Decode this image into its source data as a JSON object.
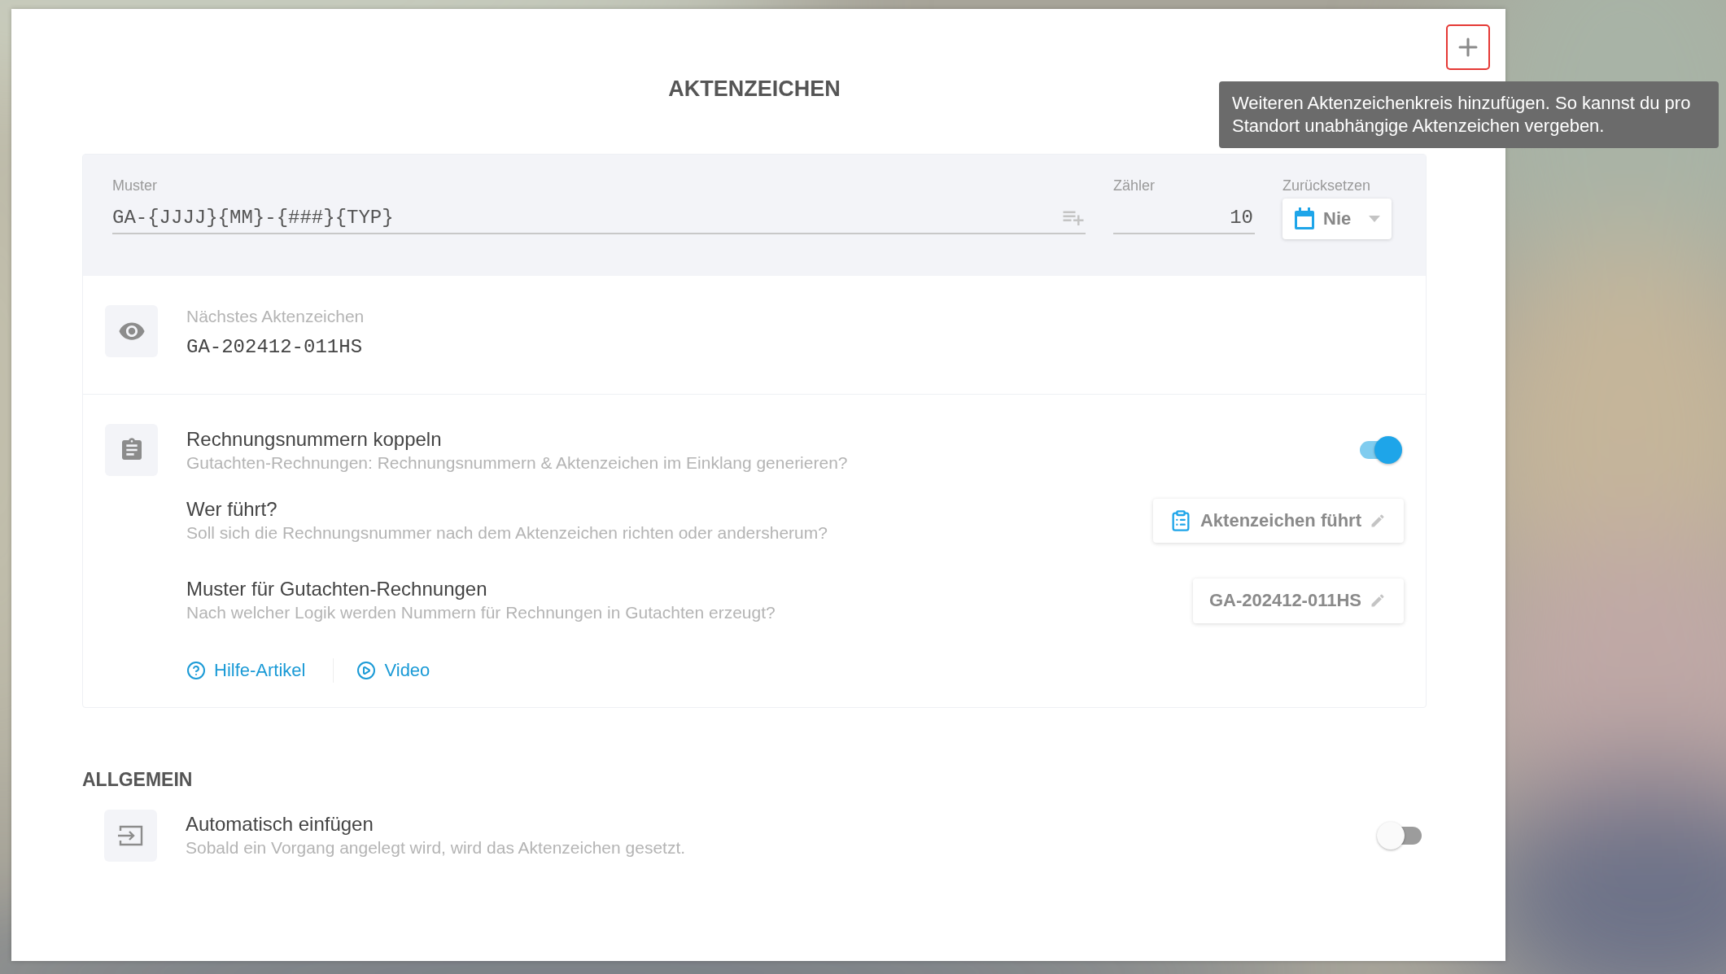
{
  "header": {
    "title": "AKTENZEICHEN",
    "add_button": {
      "tooltip": "Weiteren Aktenzeichenkreis hinzufügen. So kannst du pro Standort unabhängige Aktenzeichen vergeben."
    }
  },
  "pattern_form": {
    "fields": [
      {
        "kind": "pattern",
        "label": "Muster",
        "value": "GA-{JJJJ}{MM}-{###}{TYP}"
      },
      {
        "kind": "number",
        "label": "Zähler",
        "value": "10"
      },
      {
        "kind": "select",
        "label": "Zurücksetzen",
        "value": "Nie"
      }
    ]
  },
  "next_number": {
    "label": "Nächstes Aktenzeichen",
    "value": "GA-202412-011HS"
  },
  "coupling": {
    "title": "Rechnungsnummern koppeln",
    "subtitle": "Gutachten-Rechnungen: Rechnungsnummern & Aktenzeichen im Einklang generieren?",
    "on": true,
    "options": [
      {
        "kind": "icon",
        "title": "Wer führt?",
        "subtitle": "Soll sich die Rechnungsnummer nach dem Aktenzeichen richten oder andersherum?",
        "button": "Aktenzeichen führt"
      },
      {
        "kind": "plain",
        "title": "Muster für Gutachten-Rechnungen",
        "subtitle": "Nach welcher Logik werden Nummern für Rechnungen in Gutachten erzeugt?",
        "button": "GA-202412-011HS"
      }
    ],
    "links": [
      {
        "kind": "help",
        "label": "Hilfe-Artikel"
      },
      {
        "kind": "video",
        "label": "Video"
      }
    ]
  },
  "general": {
    "title": "ALLGEMEIN",
    "settings": [
      {
        "title": "Automatisch einfügen",
        "subtitle": "Sobald ein Vorgang angelegt wird, wird das Aktenzeichen gesetzt.",
        "on": false
      }
    ]
  }
}
